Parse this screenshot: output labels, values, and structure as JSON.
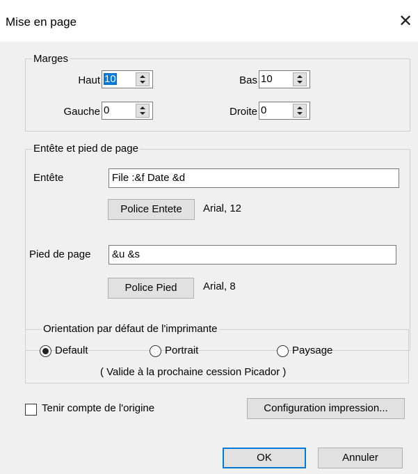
{
  "window": {
    "title": "Mise en page",
    "close_icon": "close-icon"
  },
  "margins": {
    "legend": "Marges",
    "top_label": "Haut",
    "top_value": "10",
    "bottom_label": "Bas",
    "bottom_value": "10",
    "left_label": "Gauche",
    "left_value": "0",
    "right_label": "Droite",
    "right_value": "0"
  },
  "header_footer": {
    "legend": "Entête et pied de page",
    "header_label": "Entête",
    "header_value": "File :&f Date &d",
    "header_font_button": "Police Entete",
    "header_font_info": "Arial,  12",
    "footer_label": "Pied de page",
    "footer_value": "&u &s",
    "footer_font_button": "Police Pied",
    "footer_font_info": "Arial,  8"
  },
  "orientation": {
    "legend": "Orientation par défaut de l'imprimante",
    "options": [
      {
        "label": "Default",
        "checked": true
      },
      {
        "label": "Portrait",
        "checked": false
      },
      {
        "label": "Paysage",
        "checked": false
      }
    ],
    "note": "( Valide à la prochaine cession Picador )"
  },
  "origin_checkbox": {
    "label": "Tenir compte de l'origine",
    "checked": false
  },
  "buttons": {
    "print_config": "Configuration impression...",
    "ok": "OK",
    "cancel": "Annuler"
  },
  "colors": {
    "selection": "#0078d7",
    "dialog_bg": "#f0f0f0"
  }
}
